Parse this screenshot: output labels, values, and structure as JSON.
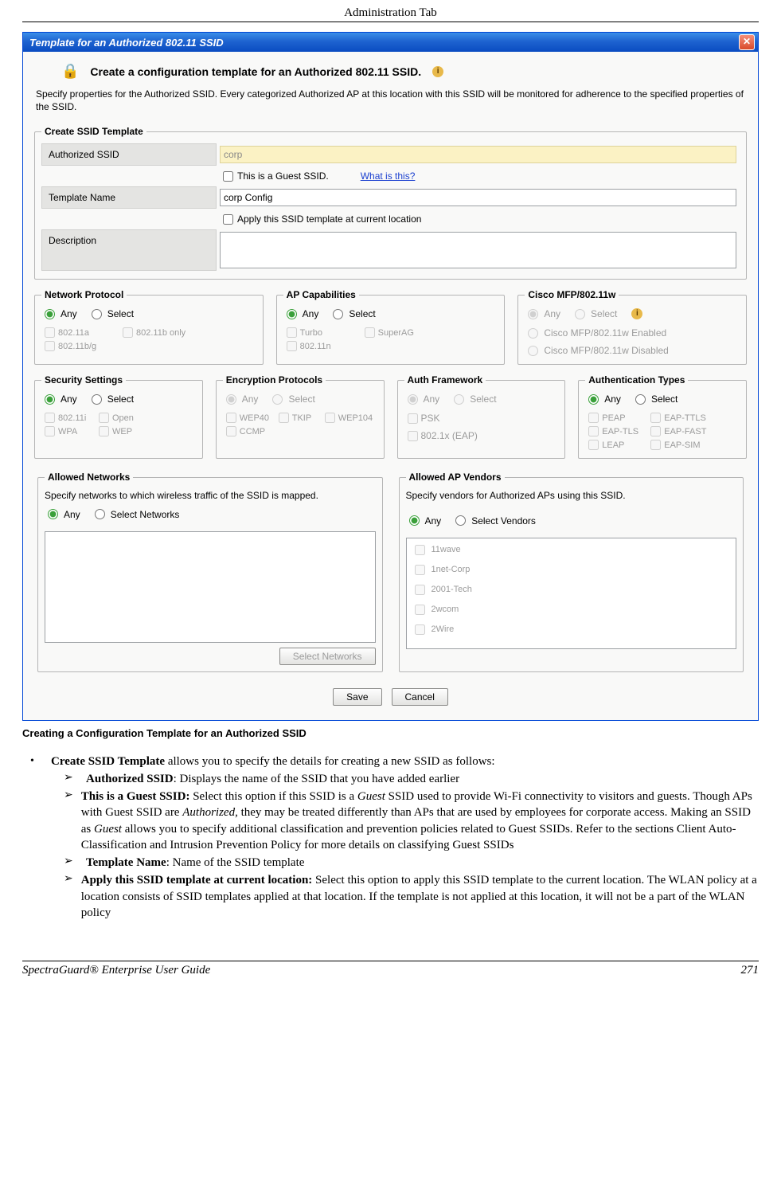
{
  "page": {
    "header": "Administration Tab",
    "footer_left": "SpectraGuard® Enterprise User Guide",
    "footer_right": "271"
  },
  "dialog": {
    "title": "Template for an Authorized 802.11 SSID",
    "heading": "Create a configuration template for an Authorized 802.11 SSID.",
    "description": "Specify properties for the Authorized SSID. Every categorized Authorized AP at this location with this SSID will be monitored for adherence to the specified properties of the SSID.",
    "fieldset_ssid": {
      "legend": "Create SSID Template",
      "authorized_ssid_label": "Authorized SSID",
      "authorized_ssid_value": "corp",
      "guest_ssid_label": "This is a Guest SSID.",
      "what_is_this": "What is this?",
      "template_name_label": "Template Name",
      "template_name_value": "corp Config",
      "apply_location_label": "Apply this SSID template at current location",
      "description_label": "Description",
      "description_value": ""
    },
    "network_protocol": {
      "legend": "Network Protocol",
      "any": "Any",
      "select": "Select",
      "opt1": "802.11a",
      "opt2": "802.11b only",
      "opt3": "802.11b/g"
    },
    "ap_capabilities": {
      "legend": "AP Capabilities",
      "any": "Any",
      "select": "Select",
      "opt1": "Turbo",
      "opt2": "SuperAG",
      "opt3": "802.11n"
    },
    "cisco_mfp": {
      "legend": "Cisco MFP/802.11w",
      "any": "Any",
      "select": "Select",
      "opt1": "Cisco MFP/802.11w Enabled",
      "opt2": "Cisco MFP/802.11w Disabled"
    },
    "security": {
      "legend": "Security Settings",
      "any": "Any",
      "select": "Select",
      "opt1": "802.11i",
      "opt2": "Open",
      "opt3": "WPA",
      "opt4": "WEP"
    },
    "encryption": {
      "legend": "Encryption Protocols",
      "any": "Any",
      "select": "Select",
      "opt1": "WEP40",
      "opt2": "TKIP",
      "opt3": "WEP104",
      "opt4": "CCMP"
    },
    "auth_framework": {
      "legend": "Auth Framework",
      "any": "Any",
      "select": "Select",
      "opt1": "PSK",
      "opt2": "802.1x (EAP)"
    },
    "auth_types": {
      "legend": "Authentication Types",
      "any": "Any",
      "select": "Select",
      "opt1": "PEAP",
      "opt2": "EAP-TTLS",
      "opt3": "EAP-TLS",
      "opt4": "EAP-FAST",
      "opt5": "LEAP",
      "opt6": "EAP-SIM"
    },
    "allowed_networks": {
      "legend": "Allowed Networks",
      "text": "Specify networks to which wireless traffic of the SSID is mapped.",
      "any": "Any",
      "select": "Select Networks",
      "select_btn": "Select Networks"
    },
    "allowed_vendors": {
      "legend": "Allowed AP Vendors",
      "text": "Specify vendors for Authorized APs using this SSID.",
      "any": "Any",
      "select": "Select Vendors",
      "items": [
        "11wave",
        "1net-Corp",
        "2001-Tech",
        "2wcom",
        "2Wire"
      ]
    },
    "buttons": {
      "save": "Save",
      "cancel": "Cancel"
    }
  },
  "caption": "Creating a Configuration Template for an Authorized SSID",
  "doc": {
    "l1": "Create SSID Template",
    "l1_rest": " allows you to specify the details for creating a new SSID as follows:",
    "a1b": "Authorized SSID",
    "a1r": ": Displays the name of the SSID that you have added earlier",
    "a2b": "This is a Guest SSID:",
    "a2r1": " Select this option if this SSID is a ",
    "a2i1": "Guest",
    "a2r2": " SSID used to provide Wi-Fi connectivity to visitors and guests. Though APs with Guest SSID are ",
    "a2i2": "Authorized",
    "a2r3": ", they may be treated differently than APs that are used by employees for corporate access. Making an SSID as ",
    "a2i3": "Guest",
    "a2r4": " allows you to specify additional classification and prevention policies related to Guest SSIDs. Refer to the sections Client Auto-Classification and Intrusion Prevention Policy for more details on classifying Guest SSIDs",
    "a3b": "Template Name",
    "a3r": ": Name of the SSID template",
    "a4b": "Apply this SSID template at current location:",
    "a4r": " Select this option to apply this SSID template to the current location. The WLAN policy at a location consists of SSID templates applied at that location. If the template is not applied at this location, it will not be a part of the WLAN policy"
  }
}
